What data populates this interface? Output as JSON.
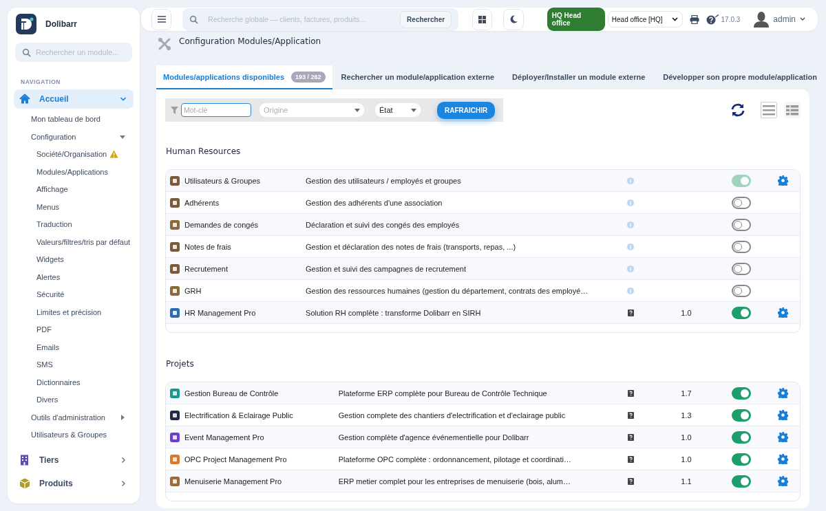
{
  "sidebar": {
    "brand": "Dolibarr",
    "search": {
      "placeholder": "Rechercher un module..."
    },
    "section": "NAVIGATION",
    "items": [
      {
        "label": "Accueil",
        "selected": true,
        "expanded": true,
        "children": [
          {
            "label": "Mon tableau de bord"
          },
          {
            "label": "Configuration",
            "expanded": true,
            "children": [
              {
                "label": "Société/Organisation",
                "warning": true
              },
              {
                "label": "Modules/Applications"
              },
              {
                "label": "Affichage"
              },
              {
                "label": "Menus"
              },
              {
                "label": "Traduction"
              },
              {
                "label": "Valeurs/filtres/tris par défaut"
              },
              {
                "label": "Widgets"
              },
              {
                "label": "Alertes"
              },
              {
                "label": "Sécurité"
              },
              {
                "label": "Limites et précision"
              },
              {
                "label": "PDF"
              },
              {
                "label": "Emails"
              },
              {
                "label": "SMS"
              },
              {
                "label": "Dictionnaires"
              },
              {
                "label": "Divers"
              }
            ]
          },
          {
            "label": "Outils d'administration",
            "expanded": false
          },
          {
            "label": "Utilisateurs & Groupes"
          }
        ]
      },
      {
        "label": "Tiers",
        "selected": false,
        "expanded": false
      },
      {
        "label": "Produits",
        "selected": false,
        "expanded": false
      }
    ]
  },
  "topbar": {
    "search": {
      "placeholder": "Recherche globale — clients, factures, produits...",
      "button": "Rechercher"
    },
    "entity_badge": "HQ Head office",
    "entity_select": "Head office [HQ]",
    "version": "17.0.3",
    "user": "admin"
  },
  "page": {
    "title": "Configuration Modules/Application",
    "tabs": [
      {
        "label": "Modules/applications disponibles",
        "count": "193 / 262",
        "selected": true
      },
      {
        "label": "Rechercher un module/application externe",
        "selected": false
      },
      {
        "label": "Déployer/Installer un module externe",
        "selected": false
      },
      {
        "label": "Développer son propre module/application",
        "selected": false
      }
    ],
    "filters": {
      "keyword": {
        "placeholder": "Mot-clé"
      },
      "origin": {
        "placeholder": "Origine"
      },
      "state": {
        "value": "État"
      },
      "button": "RAFRAICHIR"
    },
    "view_modes": [
      {
        "kind": "list",
        "selected": true
      },
      {
        "kind": "detailed",
        "selected": false
      }
    ],
    "sections": [
      {
        "title": "Human Resources",
        "modules": [
          {
            "name": "Utilisateurs & Groupes",
            "description": "Gestion des utilisateurs / employés et groupes",
            "kind": "core",
            "enabled": true,
            "locked": true,
            "configurable": true,
            "color": "#7a5a3a"
          },
          {
            "name": "Adhérents",
            "description": "Gestion des adhérents d'une association",
            "kind": "core",
            "enabled": false,
            "locked": false,
            "configurable": false,
            "color": "#7a5a3a"
          },
          {
            "name": "Demandes de congés",
            "description": "Déclaration et suivi des congés des employés",
            "kind": "core",
            "enabled": false,
            "locked": false,
            "configurable": false,
            "color": "#8a6a3a"
          },
          {
            "name": "Notes de frais",
            "description": "Gestion et déclaration des notes de frais (transports, repas, ...)",
            "kind": "core",
            "enabled": false,
            "locked": false,
            "configurable": false,
            "color": "#7a5a3a"
          },
          {
            "name": "Recrutement",
            "description": "Gestion et suivi des campagnes de recrutement",
            "kind": "core",
            "enabled": false,
            "locked": false,
            "configurable": false,
            "color": "#7a5a3a"
          },
          {
            "name": "GRH",
            "description": "Gestion des ressources humaines (gestion du département, contrats des employé…",
            "kind": "core",
            "enabled": false,
            "locked": false,
            "configurable": false,
            "color": "#8a6a3a"
          },
          {
            "name": "HR Management Pro",
            "description": "Solution RH complète : transforme Dolibarr en SIRH",
            "kind": "external",
            "version": "1.0",
            "enabled": true,
            "locked": false,
            "configurable": true,
            "color": "#2b6cb0"
          }
        ]
      },
      {
        "title": "Projets",
        "modules": [
          {
            "name": "Gestion Bureau de Contrôle",
            "description": "Plateforme ERP complète pour Bureau de Contrôle Technique",
            "kind": "external",
            "version": "1.7",
            "enabled": true,
            "locked": false,
            "configurable": true,
            "color": "#17998e"
          },
          {
            "name": "Electrification & Eclairage Public",
            "description": "Gestion complete des chantiers d'electrification et d'eclairage public",
            "kind": "external",
            "version": "1.3",
            "enabled": true,
            "locked": false,
            "configurable": true,
            "color": "#1f2a44"
          },
          {
            "name": "Event Management Pro",
            "description": "Gestion complète d'agence événementielle pour Dolibarr",
            "kind": "external",
            "version": "1.0",
            "enabled": true,
            "locked": false,
            "configurable": true,
            "color": "#6b3fd4"
          },
          {
            "name": "OPC Project Management Pro",
            "description": "Plateforme OPC complète : ordonnancement, pilotage et coordinati…",
            "kind": "external",
            "version": "1.0",
            "enabled": true,
            "locked": false,
            "configurable": true,
            "color": "#e0782a"
          },
          {
            "name": "Menuiserie Management Pro",
            "description": "ERP metier complet pour les entreprises de menuiserie (bois, alum…",
            "kind": "external",
            "version": "1.1",
            "enabled": true,
            "locked": false,
            "configurable": true,
            "color": "#9a6a3a"
          }
        ]
      }
    ]
  }
}
